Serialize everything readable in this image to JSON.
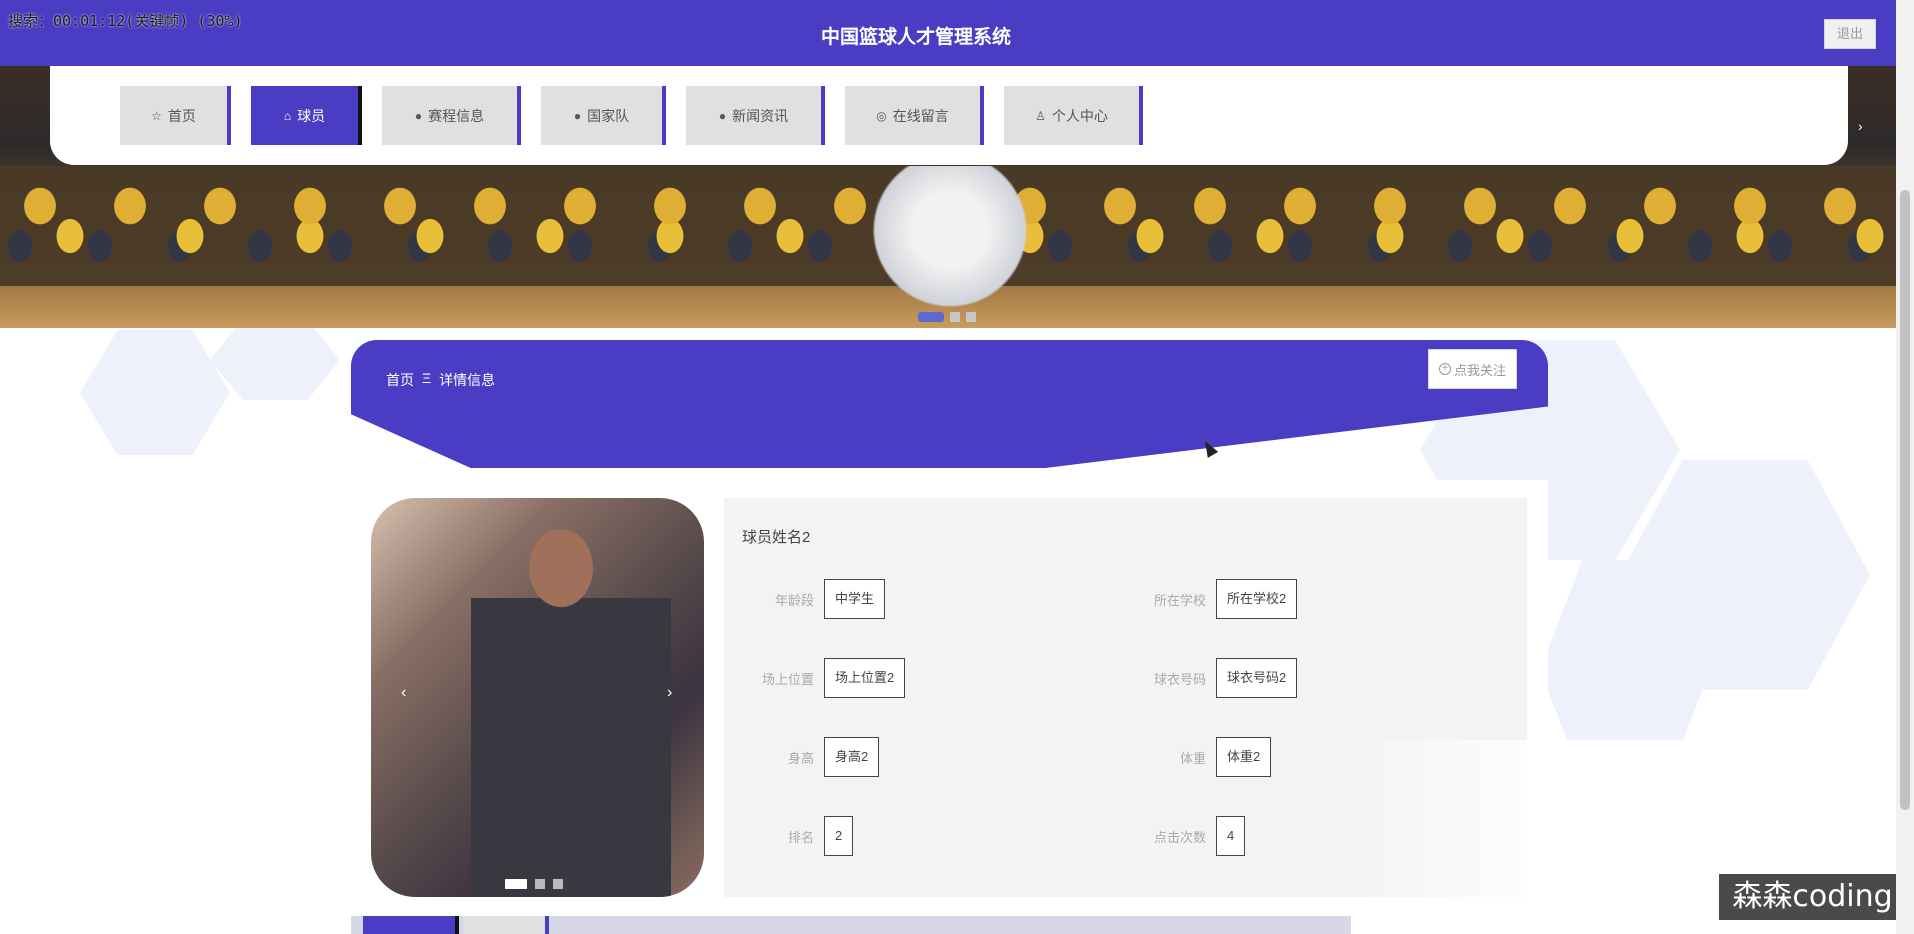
{
  "app": {
    "title": "中国篮球人才管理系统",
    "logout_label": "退出",
    "recording_overlay": "搜索：00:01:12(关键帧) (30%)"
  },
  "nav": {
    "items": [
      {
        "label": "首页",
        "icon": "star-icon"
      },
      {
        "label": "球员",
        "icon": "bag-icon",
        "active": true
      },
      {
        "label": "赛程信息",
        "icon": "info-icon"
      },
      {
        "label": "国家队",
        "icon": "help-icon"
      },
      {
        "label": "新闻资讯",
        "icon": "info-icon"
      },
      {
        "label": "在线留言",
        "icon": "globe-icon"
      },
      {
        "label": "个人中心",
        "icon": "user-icon"
      }
    ]
  },
  "banner": {
    "slide_count": 3,
    "active_slide": 1
  },
  "breadcrumb": {
    "home": "首页",
    "separator": "Ξ",
    "current": "详情信息"
  },
  "follow_button": {
    "label": "点我关注"
  },
  "player": {
    "name": "球员姓名2",
    "fields": [
      {
        "label": "年龄段",
        "value": "中学生"
      },
      {
        "label": "所在学校",
        "value": "所在学校2"
      },
      {
        "label": "场上位置",
        "value": "场上位置2"
      },
      {
        "label": "球衣号码",
        "value": "球衣号码2"
      },
      {
        "label": "身高",
        "value": "身高2"
      },
      {
        "label": "体重",
        "value": "体重2"
      },
      {
        "label": "排名",
        "value": "2"
      },
      {
        "label": "点击次数",
        "value": "4"
      }
    ]
  },
  "carousel": {
    "prev": "‹",
    "next": "›",
    "slide_count": 3,
    "active_slide": 1
  },
  "watermark": "森森coding",
  "colors": {
    "primary": "#4a3dc4",
    "nav_inactive": "#e0e0e0",
    "panel_bg": "#f3f3f5"
  }
}
